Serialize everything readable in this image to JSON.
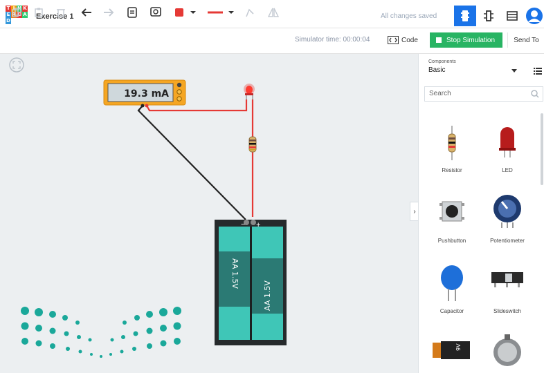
{
  "app": {
    "title": "Exercise 1",
    "saved_status": "All changes saved",
    "logo_letters": [
      "T",
      "I",
      "N",
      "K",
      "E",
      "R",
      "C",
      "A",
      "D"
    ]
  },
  "toolbar": {
    "simulator_time": "Simulator time: 00:00:04",
    "code_label": "Code",
    "stop_label": "Stop Simulation",
    "send_label": "Send To"
  },
  "canvas": {
    "multimeter_reading": "19.3 mA",
    "battery_label_left": "AA 1.5V",
    "battery_label_right": "AA 1.5V",
    "minus_sign": "−",
    "plus_sign": "+",
    "wire_colors": {
      "negative": "#222222",
      "positive": "#e53935"
    }
  },
  "panel": {
    "components_label": "Components",
    "category": "Basic",
    "search_placeholder": "Search",
    "collapse_glyph": "›",
    "items": [
      {
        "label": "Resistor",
        "icon": "resistor-icon"
      },
      {
        "label": "LED",
        "icon": "led-icon"
      },
      {
        "label": "Pushbutton",
        "icon": "pushbutton-icon"
      },
      {
        "label": "Potentiometer",
        "icon": "potentiometer-icon"
      },
      {
        "label": "Capacitor",
        "icon": "capacitor-icon"
      },
      {
        "label": "Slideswitch",
        "icon": "slideswitch-icon"
      },
      {
        "label": "",
        "icon": "battery-9v-icon"
      },
      {
        "label": "",
        "icon": "coin-cell-icon"
      }
    ]
  },
  "colors": {
    "accent_blue": "#1a73e8",
    "stop_green": "#28b463",
    "canvas_bg": "#eceff1",
    "battery_teal": "#3fc6b7"
  }
}
